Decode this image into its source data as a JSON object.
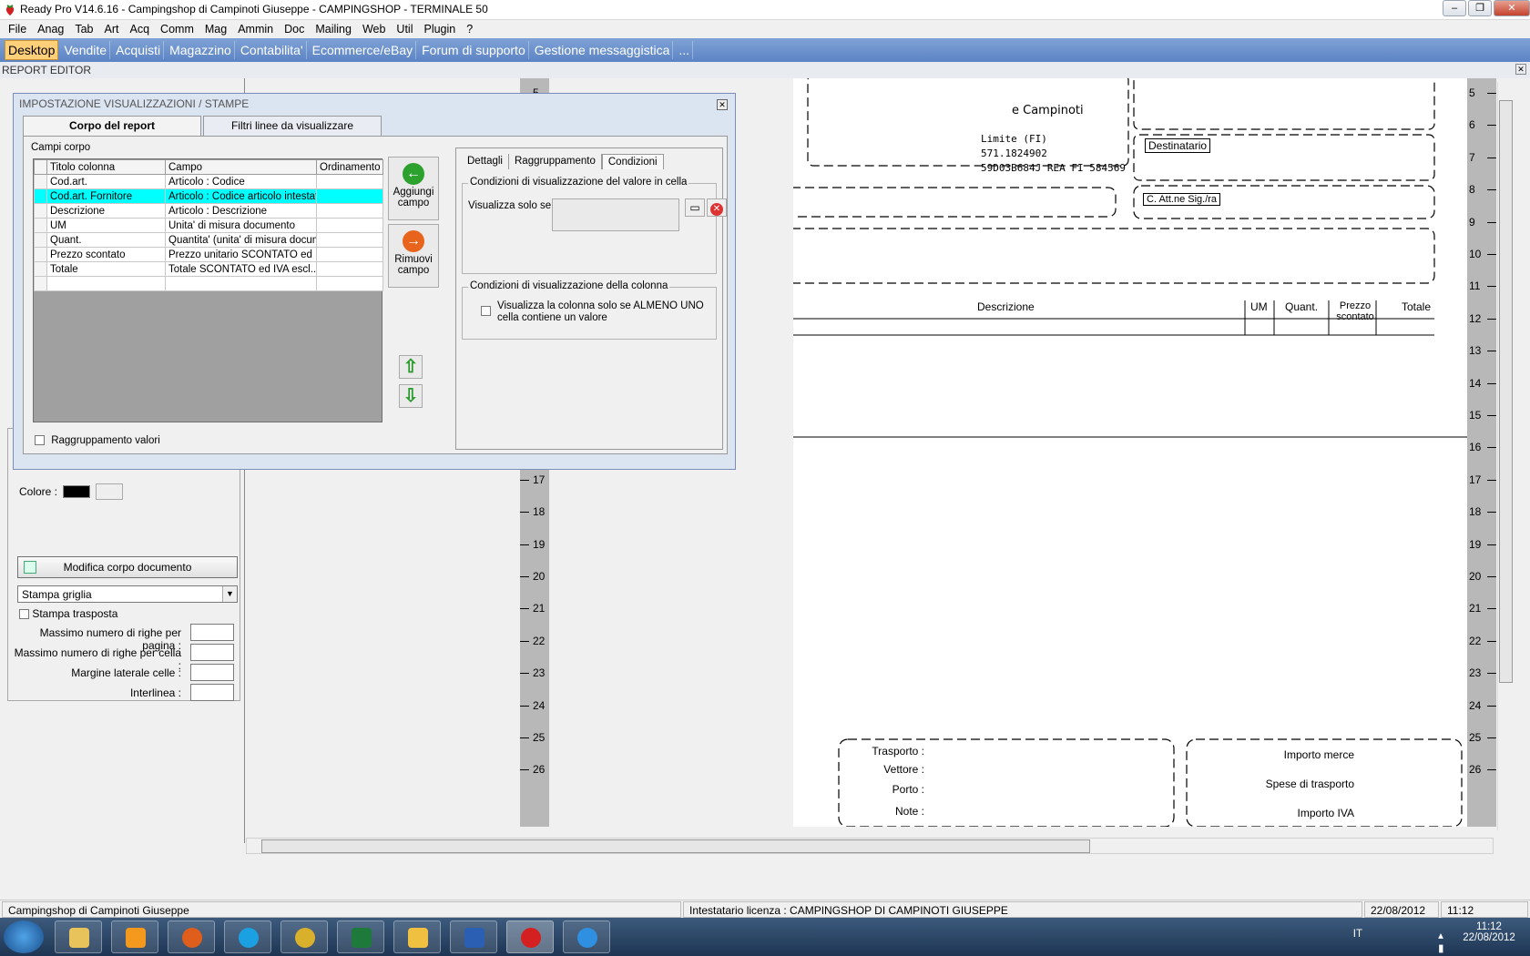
{
  "window": {
    "title": "Ready Pro V14.6.16 - Campingshop di Campinoti Giuseppe - CAMPINGSHOP - TERMINALE 50"
  },
  "menu": [
    "File",
    "Anag",
    "Tab",
    "Art",
    "Acq",
    "Comm",
    "Mag",
    "Ammin",
    "Doc",
    "Mailing",
    "Web",
    "Util",
    "Plugin",
    "?"
  ],
  "modules": [
    "Desktop",
    "Vendite",
    "Acquisti",
    "Magazzino",
    "Contabilita'",
    "Ecommerce/eBay",
    "Forum di supporto",
    "Gestione messaggistica",
    "..."
  ],
  "report_editor_label": "REPORT EDITOR",
  "left_panel": {
    "colore_label": "Colore :",
    "modifica_button": "Modifica corpo documento",
    "select_value": "Stampa griglia",
    "stampa_trasposta": "Stampa trasposta",
    "fields": [
      "Massimo numero di righe per pagina :",
      "Massimo numero di righe per cella :",
      "Margine laterale celle :",
      "Interlinea :"
    ]
  },
  "dialog": {
    "title": "IMPOSTAZIONE VISUALIZZAZIONI / STAMPE",
    "tabs": [
      "Corpo del report",
      "Filtri linee da visualizzare"
    ],
    "campi_label": "Campi corpo",
    "columns": [
      "Titolo colonna",
      "Campo",
      "Ordinamento"
    ],
    "rows": [
      [
        "Cod.art.",
        "Articolo : Codice",
        ""
      ],
      [
        "Cod.art. Fornitore",
        "Articolo : Codice articolo intestat...",
        ""
      ],
      [
        "Descrizione",
        "Articolo : Descrizione",
        ""
      ],
      [
        "UM",
        "Unita' di misura documento",
        ""
      ],
      [
        "Quant.",
        "Quantita' (unita' di misura docum...",
        ""
      ],
      [
        "Prezzo scontato",
        "Prezzo unitario SCONTATO ed I...",
        ""
      ],
      [
        "Totale",
        "Totale SCONTATO ed IVA escl...",
        ""
      ],
      [
        "",
        "",
        ""
      ]
    ],
    "selected_row": 1,
    "aggiungi": "Aggiungi campo",
    "rimuovi": "Rimuovi campo",
    "raggruppamento_valori": "Raggruppamento valori",
    "subtabs": [
      "Dettagli",
      "Raggruppamento",
      "Condizioni"
    ],
    "group1_title": "Condizioni di visualizzazione del valore in cella",
    "visualizza_label": "Visualizza solo se :",
    "group2_title": "Condizioni di visualizzazione della colonna",
    "group2_check": "Visualizza la colonna solo se ALMENO UNO cella contiene un valore"
  },
  "report_page": {
    "company": "e Campinoti",
    "line2": "Limite (FI)",
    "line3": "571.1824902",
    "line4": "59D03B684J REA FI 584569",
    "destinatario": "Destinatario",
    "att": "C. Att.ne Sig./ra",
    "cols": [
      "Descrizione",
      "UM",
      "Quant.",
      "Prezzo scontato",
      "Totale"
    ],
    "footer_left": [
      "Trasporto :",
      "Vettore :",
      "Porto :",
      "Note :"
    ],
    "footer_right": [
      "Importo merce",
      "Spese di trasporto",
      "Importo IVA"
    ]
  },
  "ruler_ticks": [
    5,
    6,
    7,
    8,
    9,
    10,
    11,
    12,
    13,
    14,
    15,
    16,
    17,
    18,
    19,
    20,
    21,
    22,
    23,
    24,
    25,
    26
  ],
  "status": {
    "left": "Campingshop di Campinoti Giuseppe",
    "licenza": "Intestatario licenza : CAMPINGSHOP DI CAMPINOTI GIUSEPPE",
    "date": "22/08/2012",
    "time": "11:12"
  },
  "taskbar": {
    "lang": "IT",
    "clock_time": "11:12",
    "clock_date": "22/08/2012"
  },
  "colors": {
    "module_bar": "#5c83c4",
    "selected_row": "#00ffff",
    "active_module": "#ffcf7a"
  }
}
